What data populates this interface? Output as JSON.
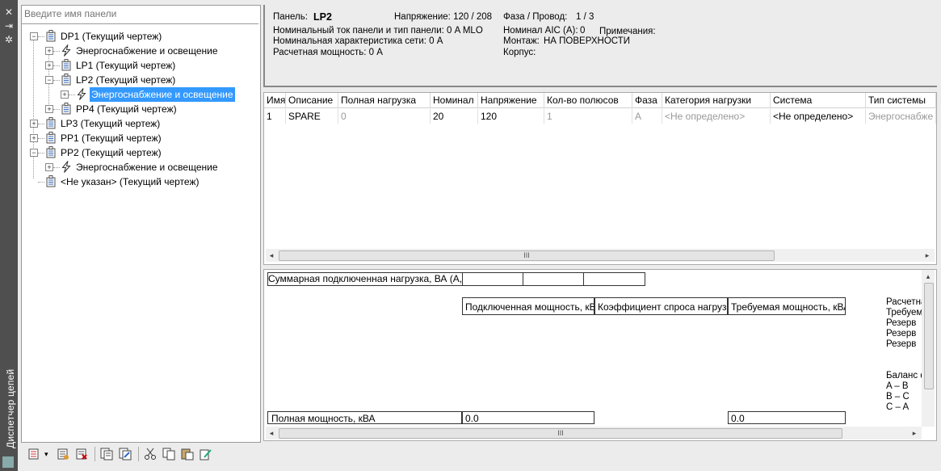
{
  "palette": "Диспетчер цепей",
  "search": {
    "placeholder": "Введите имя панели",
    "value": ""
  },
  "tree": [
    {
      "label": "DP1 (Текущий чертеж)",
      "icon": "panel-icon"
    },
    {
      "label": "Энергоснабжение и освещение",
      "icon": "lightning-icon"
    },
    {
      "label": "LP1 (Текущий чертеж)",
      "icon": "panel-icon"
    },
    {
      "label": "LP2 (Текущий чертеж)",
      "icon": "panel-icon"
    },
    {
      "label": "Энергоснабжение и освещение",
      "icon": "lightning-icon",
      "selected": true
    },
    {
      "label": "PP4 (Текущий чертеж)",
      "icon": "panel-icon"
    },
    {
      "label": "LP3 (Текущий чертеж)",
      "icon": "panel-icon"
    },
    {
      "label": "PP1 (Текущий чертеж)",
      "icon": "panel-icon"
    },
    {
      "label": "PP2 (Текущий чертеж)",
      "icon": "panel-icon"
    },
    {
      "label": "Энергоснабжение и освещение",
      "icon": "lightning-icon"
    },
    {
      "label": "<Не указан> (Текущий чертеж)",
      "icon": "panel-icon"
    }
  ],
  "info": {
    "panel_label": "Панель:",
    "panel_value": "LP2",
    "voltage": "Напряжение: 120 / 208",
    "phase_label": "Фаза / Провод:",
    "phase_value": "1 /  3",
    "nominal_current": "Номинальный ток панели и тип панели: 0 A MLO",
    "nominal_aic_label": "Номинал AIC (A):",
    "nominal_aic_value": "0",
    "notes_label": "Примечания:",
    "network_char": "Номинальная характеристика сети: 0 A",
    "mounting_label": "Монтаж:",
    "mounting_value": "НА ПОВЕРХНОСТИ",
    "calc_power": "Расчетная мощность: 0 A",
    "enclosure_label": "Корпус:"
  },
  "grid": {
    "headers": [
      "Имя",
      "Описание",
      "Полная нагрузка",
      "Номинал",
      "Напряжение",
      "Кол-во полюсов",
      "Фаза",
      "Категория нагрузки",
      "Система",
      "Тип системы"
    ],
    "rows": [
      [
        "1",
        "SPARE",
        "0",
        "20",
        "120",
        "1",
        "A",
        "<Не определено>",
        "<Не определено>",
        "Энергоснабже"
      ]
    ],
    "scroll_thumb": "III"
  },
  "summary": {
    "connected_load": "Суммарная подключенная нагрузка, ВА (А,В,С)",
    "headers": [
      "Подключенная мощность, кВА",
      "Коэффициент спроса нагрузки",
      "Требуемая мощность, кВА"
    ],
    "total_label": "Полная мощность, кВА",
    "total_connected": "0.0",
    "total_required": "0.0",
    "right_labels": [
      "Расчетна",
      "Требуем",
      "Резерв",
      "Резерв",
      "Резерв"
    ],
    "balance_label": "Баланс ф",
    "balance_items": [
      "A – B",
      "B – C",
      "C – A"
    ],
    "scroll_thumb": "III"
  },
  "toolbar": {
    "icons": [
      "new-panel-icon",
      "dropdown-arrow-icon",
      "panel-properties-icon",
      "delete-panel-icon",
      "schedule-icon",
      "schedule-edit-icon",
      "cut-icon",
      "copy-icon",
      "paste-icon",
      "edit-icon"
    ]
  }
}
